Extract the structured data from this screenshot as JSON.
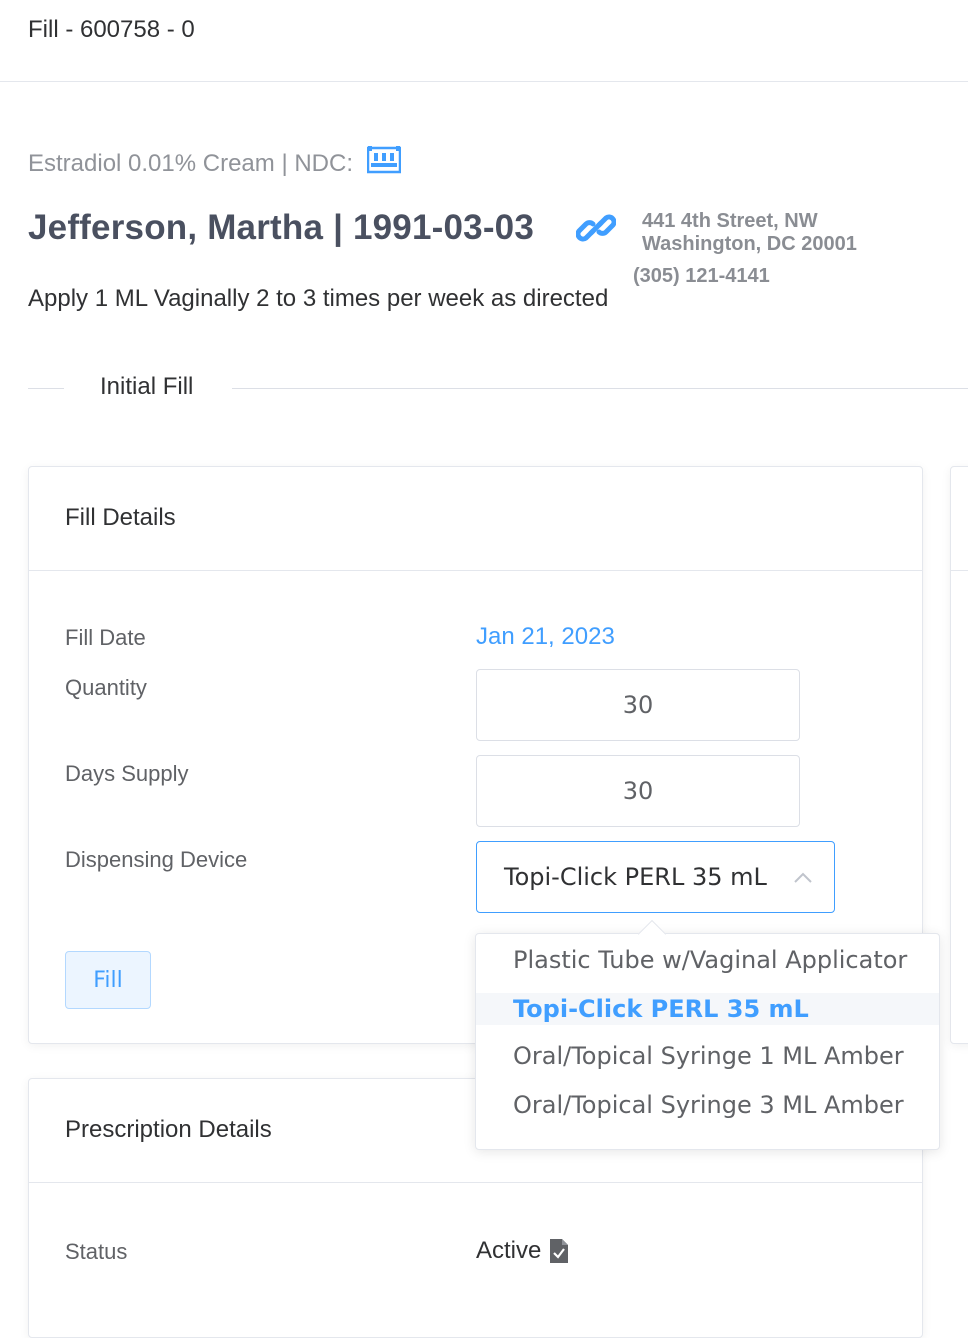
{
  "header": {
    "title": "Fill - 600758 - 0"
  },
  "drug": {
    "line": "Estradiol 0.01% Cream | NDC:",
    "ndc_icon": "barcode-icon"
  },
  "patient": {
    "name_dob": "Jefferson, Martha | 1991-03-03",
    "link_icon": "link-icon",
    "address_line1": "441 4th Street, NW",
    "address_line2": "Washington, DC 20001",
    "phone": "(305) 121-4141"
  },
  "sig": "Apply 1 ML Vaginally 2 to 3 times per week as directed",
  "section_divider": "Initial Fill",
  "fill_details": {
    "title": "Fill Details",
    "fill_date_label": "Fill Date",
    "fill_date_value": "Jan 21, 2023",
    "quantity_label": "Quantity",
    "quantity_value": "30",
    "days_supply_label": "Days Supply",
    "days_supply_value": "30",
    "device_label": "Dispensing Device",
    "device_value": "Topi-Click PERL 35 mL",
    "fill_button": "Fill"
  },
  "device_options": [
    "Plastic Tube w/Vaginal Applicator",
    "Topi-Click PERL 35 mL",
    "Oral/Topical Syringe 1 ML Amber",
    "Oral/Topical Syringe 3 ML Amber"
  ],
  "device_selected_index": 1,
  "prescription_details": {
    "title": "Prescription Details",
    "status_label": "Status",
    "status_value": "Active"
  },
  "colors": {
    "accent": "#409eff",
    "text_primary": "#303133",
    "text_secondary": "#606266",
    "muted": "#909399"
  }
}
